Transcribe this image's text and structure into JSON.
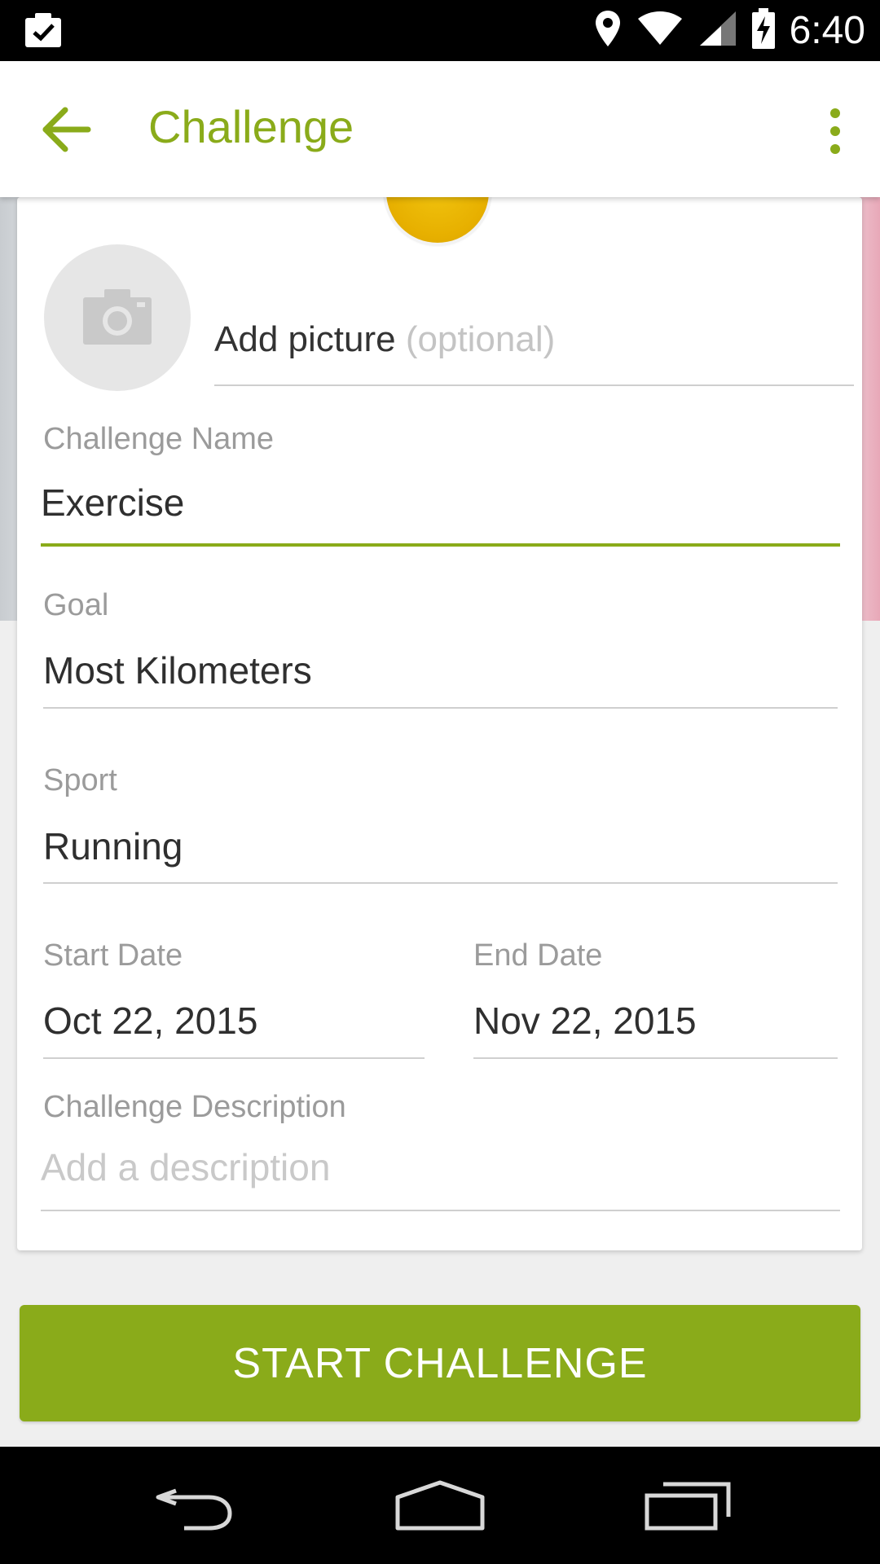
{
  "status_bar": {
    "time": "6:40",
    "icons": [
      "clipboard-check-icon",
      "location-pin-icon",
      "wifi-icon",
      "signal-icon",
      "battery-charging-icon"
    ]
  },
  "toolbar": {
    "title": "Challenge",
    "back_icon": "arrow-back-icon",
    "menu_icon": "more-vert-icon"
  },
  "picture": {
    "label": "Add picture",
    "optional": "(optional)",
    "icon": "camera-icon"
  },
  "fields": {
    "challenge_name": {
      "label": "Challenge Name",
      "value": "Exercise"
    },
    "goal": {
      "label": "Goal",
      "value": "Most Kilometers"
    },
    "sport": {
      "label": "Sport",
      "value": "Running"
    },
    "start_date": {
      "label": "Start Date",
      "value": "Oct 22, 2015"
    },
    "end_date": {
      "label": "End Date",
      "value": "Nov 22, 2015"
    },
    "description": {
      "label": "Challenge Description",
      "placeholder": "Add a description"
    }
  },
  "actions": {
    "start_label": "START CHALLENGE"
  },
  "colors": {
    "accent": "#8aab1a",
    "badge": "#e7b000"
  },
  "nav_bar": {
    "icons": [
      "nav-back-icon",
      "nav-home-icon",
      "nav-recents-icon"
    ]
  }
}
